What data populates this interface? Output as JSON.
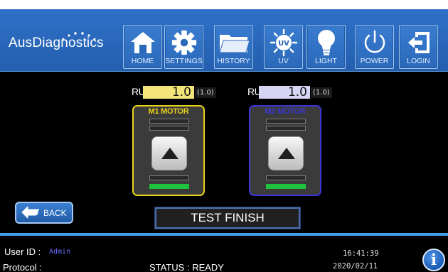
{
  "header": {
    "logo": "AusDiagnostics",
    "nav": [
      {
        "label": "HOME",
        "icon": "home-icon"
      },
      {
        "label": "SETTINGS",
        "icon": "gear-icon"
      },
      {
        "label": "HISTORY",
        "icon": "folder-icon"
      },
      {
        "label": "UV",
        "icon": "uv-lamp-icon",
        "icon_text": "UV"
      },
      {
        "label": "LIGHT",
        "icon": "lightbulb-icon"
      },
      {
        "label": "POWER",
        "icon": "power-icon"
      },
      {
        "label": "LOGIN",
        "icon": "login-icon"
      }
    ]
  },
  "motors": [
    {
      "title": "M1 MOTOR",
      "run_label": "RUN",
      "run_value": "1.0",
      "run_sub": "(1.0)",
      "color": "#e8d21a",
      "value_bg": "#f3e47a"
    },
    {
      "title": "M2 MOTOR",
      "run_label": "RUN",
      "run_value": "1.0",
      "run_sub": "(1.0)",
      "color": "#3a36d6",
      "value_bg": "#d6d6f4"
    }
  ],
  "back_button": {
    "label": "BACK",
    "icon": "back-arrow-icon"
  },
  "status_box": "TEST FINISH",
  "footer": {
    "user_id_label": "User ID :",
    "user_id_value": "Admin",
    "protocol_label": "Protocol :",
    "status": "STATUS : READY",
    "time": "16:41:39",
    "date": "2020/02/11"
  },
  "info_button": {
    "glyph": "i",
    "icon": "info-icon"
  },
  "colors": {
    "header_blue": "#2a6ab9",
    "accent": "#3fa0e6",
    "progress_green": "#1fc23b"
  }
}
